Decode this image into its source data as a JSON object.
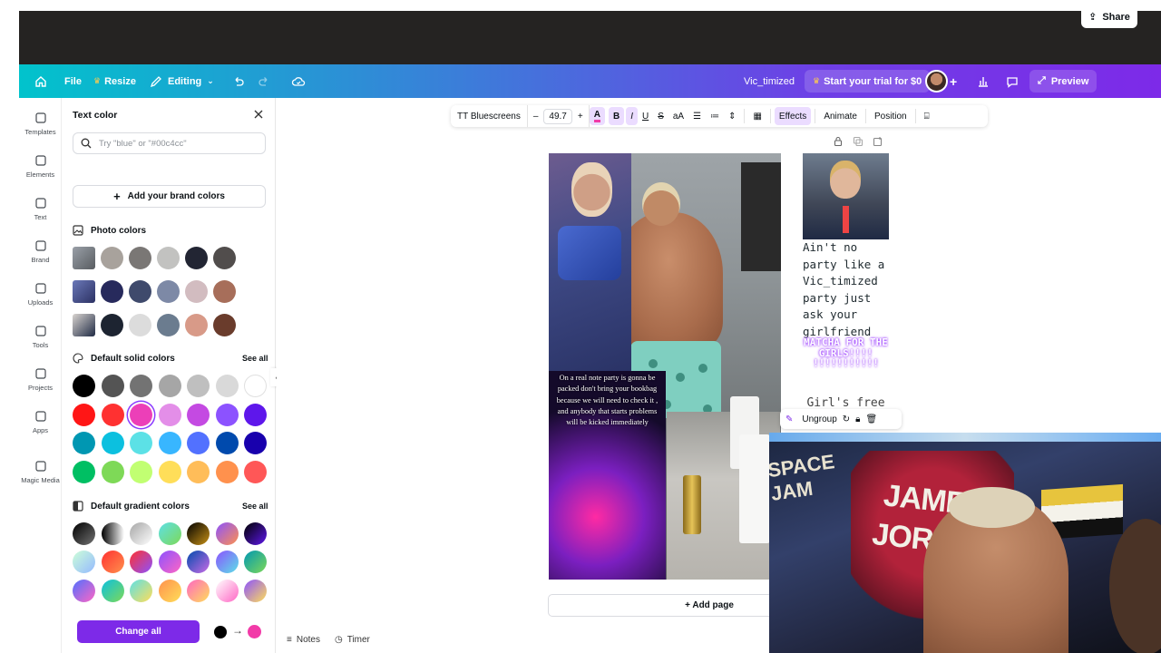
{
  "topbar": {
    "file": "File",
    "resize": "Resize",
    "editing": "Editing",
    "doc_title": "Vic_timized",
    "trial": "Start your trial for $0",
    "preview": "Preview",
    "share": "Share"
  },
  "rail": [
    {
      "label": "Templates",
      "icon": "templates-icon"
    },
    {
      "label": "Elements",
      "icon": "elements-icon"
    },
    {
      "label": "Text",
      "icon": "text-icon"
    },
    {
      "label": "Brand",
      "icon": "brand-icon"
    },
    {
      "label": "Uploads",
      "icon": "uploads-icon"
    },
    {
      "label": "Tools",
      "icon": "tools-icon"
    },
    {
      "label": "Projects",
      "icon": "projects-icon"
    },
    {
      "label": "Apps",
      "icon": "apps-icon"
    },
    {
      "label": "Magic Media",
      "icon": "magic-media-icon"
    }
  ],
  "panel": {
    "title": "Text color",
    "search_placeholder": "Try \"blue\" or \"#00c4cc\"",
    "add_brand": "Add your brand colors",
    "photo_colors": "Photo colors",
    "default_solid": "Default solid colors",
    "default_gradient": "Default gradient colors",
    "see_all": "See all",
    "change_all": "Change all",
    "photo_rows": [
      [
        "#a8a29c",
        "#7a7775",
        "#c2c2c0",
        "#222533",
        "#514d4c"
      ],
      [
        "#272a5c",
        "#3f4a6c",
        "#7d89a6",
        "#d2bcc0",
        "#a76e5a"
      ],
      [
        "#1d2431",
        "#dcdcdc",
        "#6b7c8f",
        "#d89a88",
        "#6a3c2c"
      ]
    ],
    "solid_rows": [
      [
        "#000000",
        "#545454",
        "#737373",
        "#a6a6a6",
        "#bfbfbf",
        "#d9d9d9",
        "#ffffff"
      ],
      [
        "#ff1616",
        "#ff3131",
        "#ec3fb8",
        "#e38ee8",
        "#c44ae2",
        "#8c52ff",
        "#5e17eb"
      ],
      [
        "#0097b2",
        "#0cc0df",
        "#5ce1e6",
        "#38b6ff",
        "#5271ff",
        "#004aad",
        "#1800ad"
      ],
      [
        "#00bf63",
        "#7ed957",
        "#c1ff72",
        "#ffde59",
        "#ffbd59",
        "#ff914d",
        "#ff5757"
      ]
    ],
    "gradient_rows": [
      [
        "linear-gradient(135deg,#000,#737373)",
        "linear-gradient(90deg,#000,#fff)",
        "linear-gradient(135deg,#a6a6a6,#fff)",
        "linear-gradient(135deg,#5de0e6,#7ed957)",
        "linear-gradient(135deg,#000,#c89116)",
        "linear-gradient(135deg,#8c52ff,#ff914d)",
        "linear-gradient(135deg,#000,#5e17eb)"
      ],
      [
        "linear-gradient(135deg,#cdffd8,#94b9ff)",
        "linear-gradient(135deg,#ff3131,#ff914d)",
        "linear-gradient(135deg,#ff3131,#8c52ff)",
        "linear-gradient(135deg,#8c52ff,#ff66c4)",
        "linear-gradient(135deg,#004aad,#cb6ce6)",
        "linear-gradient(135deg,#8c52ff,#5ce1e6)",
        "linear-gradient(135deg,#0097b2,#7ed957)"
      ],
      [
        "linear-gradient(135deg,#5170ff,#ff66c4)",
        "linear-gradient(135deg,#0cc0df,#7ed957)",
        "linear-gradient(135deg,#5de0e6,#ffde59)",
        "linear-gradient(135deg,#ff914d,#ffde59)",
        "linear-gradient(135deg,#ff66c4,#ffde59)",
        "linear-gradient(135deg,#ffffff,#ff66c4)",
        "linear-gradient(135deg,#8c52ff,#ffde59)"
      ]
    ],
    "from_color": "#000000",
    "to_color": "#f23aa8"
  },
  "toolbar": {
    "font": "TT Bluescreens",
    "size": "49.7",
    "effects": "Effects",
    "animate": "Animate",
    "position": "Position"
  },
  "design": {
    "party_text": "On a real note party is gonna be packed don't bring your bookbag because we will need to check it , and anybody that starts problems will be kicked immediately",
    "aint_text": "Ain't no party like a Vic_timized party just ask your girlfriend",
    "matcha": "MATCHA FOR THE GIRLS!!!! !!!!!!!!!!!",
    "girls_free": "Girl's free"
  },
  "ungroup": "Ungroup",
  "add_page": "+ Add page",
  "bottom": {
    "notes": "Notes",
    "timer": "Timer"
  },
  "webcam": {
    "line0": "SPACE JAM",
    "line1": "JAMES",
    "line2": "JORDAN"
  },
  "colors": {
    "accent": "#7d2ae8",
    "brand_teal": "#01c3cc"
  }
}
